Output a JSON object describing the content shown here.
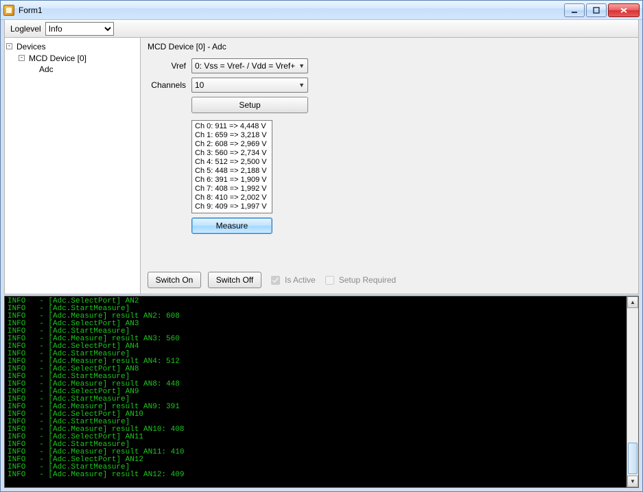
{
  "window": {
    "title": "Form1"
  },
  "toolbar": {
    "loglevel_label": "Loglevel",
    "loglevel_value": "Info"
  },
  "tree": {
    "root_label": "Devices",
    "device_label": "MCD Device [0]",
    "leaf_label": "Adc"
  },
  "panel": {
    "header": "MCD Device [0] - Adc",
    "vref_label": "Vref",
    "vref_value": "0: Vss = Vref- / Vdd = Vref+",
    "channels_label": "Channels",
    "channels_value": "10",
    "setup_label": "Setup",
    "measure_label": "Measure",
    "switch_on_label": "Switch On",
    "switch_off_label": "Switch Off",
    "is_active_label": "Is Active",
    "is_active_checked": true,
    "setup_required_label": "Setup Required",
    "setup_required_checked": false,
    "results": [
      "Ch 0:   911 => 4,448 V",
      "Ch 1:   659 => 3,218 V",
      "Ch 2:   608 => 2,969 V",
      "Ch 3:   560 => 2,734 V",
      "Ch 4:   512 => 2,500 V",
      "Ch 5:   448 => 2,188 V",
      "Ch 6:   391 => 1,909 V",
      "Ch 7:   408 => 1,992 V",
      "Ch 8:   410 => 2,002 V",
      "Ch 9:   409 => 1,997 V"
    ]
  },
  "console": {
    "lines": [
      "INFO   - [Adc.SelectPort] AN2",
      "INFO   - [Adc.StartMeasure]",
      "INFO   - [Adc.Measure] result AN2: 608",
      "INFO   - [Adc.SelectPort] AN3",
      "INFO   - [Adc.StartMeasure]",
      "INFO   - [Adc.Measure] result AN3: 560",
      "INFO   - [Adc.SelectPort] AN4",
      "INFO   - [Adc.StartMeasure]",
      "INFO   - [Adc.Measure] result AN4: 512",
      "INFO   - [Adc.SelectPort] AN8",
      "INFO   - [Adc.StartMeasure]",
      "INFO   - [Adc.Measure] result AN8: 448",
      "INFO   - [Adc.SelectPort] AN9",
      "INFO   - [Adc.StartMeasure]",
      "INFO   - [Adc.Measure] result AN9: 391",
      "INFO   - [Adc.SelectPort] AN10",
      "INFO   - [Adc.StartMeasure]",
      "INFO   - [Adc.Measure] result AN10: 408",
      "INFO   - [Adc.SelectPort] AN11",
      "INFO   - [Adc.StartMeasure]",
      "INFO   - [Adc.Measure] result AN11: 410",
      "INFO   - [Adc.SelectPort] AN12",
      "INFO   - [Adc.StartMeasure]",
      "INFO   - [Adc.Measure] result AN12: 409"
    ]
  }
}
